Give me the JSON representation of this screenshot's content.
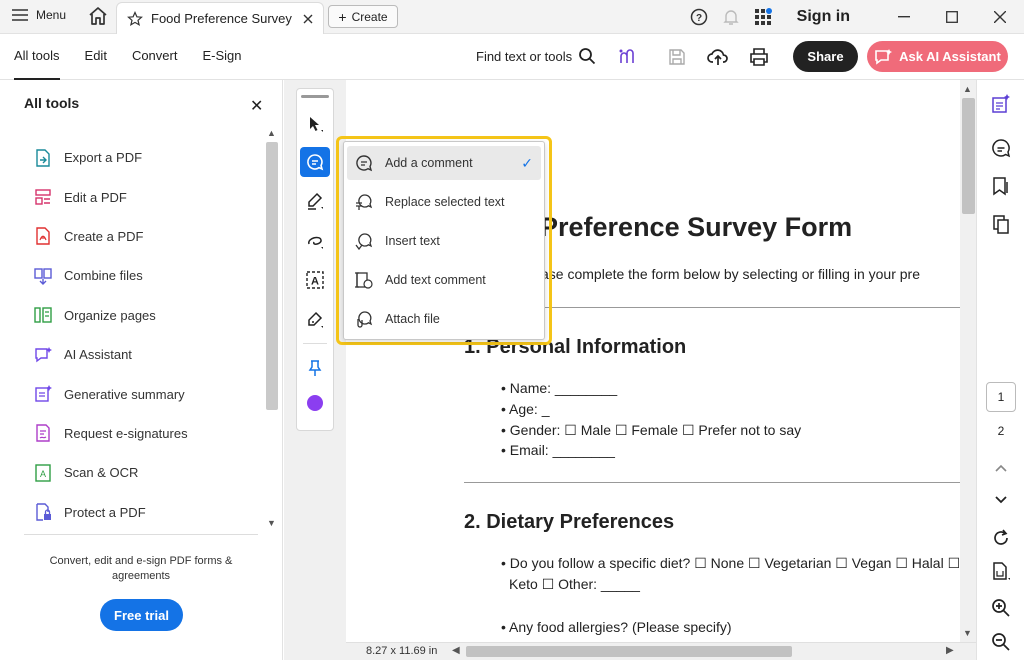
{
  "titlebar": {
    "menu_label": "Menu",
    "tab_title": "Food Preference Survey ...",
    "create_label": "Create",
    "signin_label": "Sign in"
  },
  "toolbar": {
    "tabs": [
      "All tools",
      "Edit",
      "Convert",
      "E-Sign"
    ],
    "find_label": "Find text or tools",
    "share_label": "Share",
    "ai_label": "Ask AI Assistant"
  },
  "left_panel": {
    "title": "All tools",
    "items": [
      {
        "label": "Export a PDF",
        "icon": "export-pdf-icon"
      },
      {
        "label": "Edit a PDF",
        "icon": "edit-pdf-icon"
      },
      {
        "label": "Create a PDF",
        "icon": "create-pdf-icon"
      },
      {
        "label": "Combine files",
        "icon": "combine-files-icon"
      },
      {
        "label": "Organize pages",
        "icon": "organize-pages-icon"
      },
      {
        "label": "AI Assistant",
        "icon": "ai-assistant-icon"
      },
      {
        "label": "Generative summary",
        "icon": "generative-summary-icon"
      },
      {
        "label": "Request e-signatures",
        "icon": "request-esign-icon"
      },
      {
        "label": "Scan & OCR",
        "icon": "scan-ocr-icon"
      },
      {
        "label": "Protect a PDF",
        "icon": "protect-pdf-icon"
      }
    ],
    "promo_text": "Convert, edit and e-sign PDF forms & agreements",
    "free_trial_label": "Free trial"
  },
  "comment_menu": {
    "items": [
      {
        "label": "Add a comment",
        "selected": true
      },
      {
        "label": "Replace selected text",
        "selected": false
      },
      {
        "label": "Insert text",
        "selected": false
      },
      {
        "label": "Add text comment",
        "selected": false
      },
      {
        "label": "Attach file",
        "selected": false
      }
    ]
  },
  "document": {
    "title": "Food Preference Survey Form",
    "title_visible": "Preference Survey Form",
    "instructions_visible": "s: Please complete the form below by selecting or filling in your pre",
    "section1_title": "1. Personal Information",
    "section1_fields": [
      "• Name: ________",
      "• Age: _",
      "• Gender: ☐ Male ☐ Female ☐ Prefer not to say",
      "• Email: ________"
    ],
    "section2_title": "2. Dietary Preferences",
    "section2_fields": [
      "• Do you follow a specific diet? ☐ None ☐ Vegetarian ☐ Vegan ☐ Halal ☐ K",
      "Keto ☐ Other: _____",
      "• Any food allergies? (Please specify)"
    ],
    "page_size": "8.27 x 11.69 in"
  },
  "page_nav": {
    "current_page": "1",
    "total_pages": "2"
  },
  "colors": {
    "accent": "#1473e6",
    "highlight": "#f5c518",
    "ai_button": "#f06b7a",
    "color_swatch": "#8b3ef0"
  }
}
